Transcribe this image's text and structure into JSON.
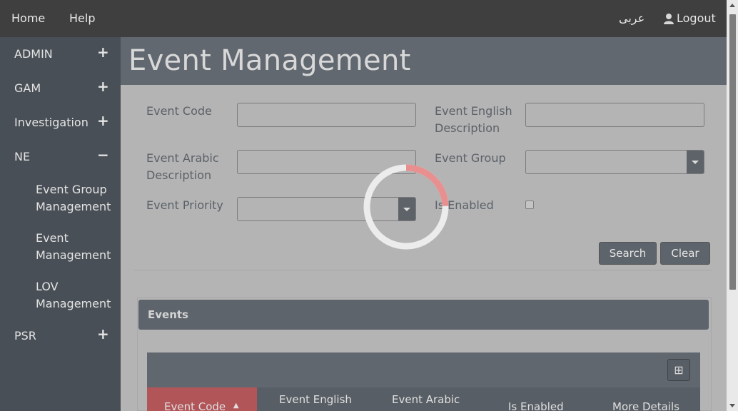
{
  "topbar": {
    "home": "Home",
    "help": "Help",
    "language": "عربى",
    "logout": "Logout"
  },
  "sidebar": {
    "items": [
      {
        "label": "ADMIN",
        "toggle": "+"
      },
      {
        "label": "GAM",
        "toggle": "+"
      },
      {
        "label": "Investigation",
        "toggle": "+"
      },
      {
        "label": "NE",
        "toggle": "−"
      },
      {
        "label": "PSR",
        "toggle": "+"
      }
    ],
    "sub_items": [
      "Event Group Management",
      "Event Management",
      "LOV Management"
    ]
  },
  "page": {
    "title": "Event Management"
  },
  "form": {
    "event_code_label": "Event Code",
    "event_english_description_label": "Event English Description",
    "event_arabic_description_label": "Event Arabic Description",
    "event_group_label": "Event Group",
    "event_priority_label": "Event Priority",
    "is_enabled_label": "Is Enabled",
    "event_code_value": "",
    "event_english_description_value": "",
    "event_arabic_description_value": "",
    "event_group_value": "",
    "event_priority_value": "",
    "is_enabled_checked": false,
    "search_button": "Search",
    "clear_button": "Clear"
  },
  "events_panel": {
    "title": "Events",
    "columns": [
      "Event Code",
      "Event English",
      "Event Arabic",
      "Is Enabled",
      "More Details"
    ],
    "sort_indicator": "▲"
  },
  "colors": {
    "accent_loading": "#e89090",
    "active_column": "#b25559",
    "topbar": "#3f3f3f",
    "sidebar": "#494f56"
  }
}
